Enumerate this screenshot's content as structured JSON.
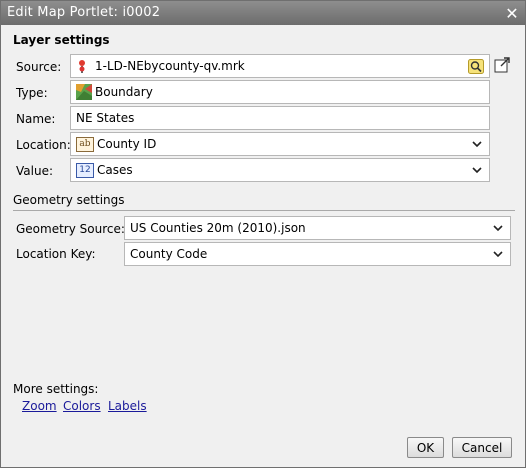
{
  "window": {
    "title": "Edit Map Portlet: i0002"
  },
  "layer": {
    "heading": "Layer settings",
    "source_label": "Source:",
    "source_value": "1-LD-NEbycounty-qv.mrk",
    "type_label": "Type:",
    "type_value": "Boundary",
    "name_label": "Name:",
    "name_value": "NE States",
    "location_label": "Location:",
    "location_value": "County ID",
    "value_label": "Value:",
    "value_value": "Cases",
    "location_type_tag": "ab",
    "value_type_tag": "12"
  },
  "geometry": {
    "heading": "Geometry settings",
    "source_label": "Geometry Source:",
    "source_value": "US Counties 20m (2010).json",
    "key_label": "Location Key:",
    "key_value": "County Code"
  },
  "more": {
    "label": "More settings:",
    "links": [
      "Zoom",
      "Colors",
      "Labels"
    ]
  },
  "buttons": {
    "ok": "OK",
    "cancel": "Cancel"
  },
  "colors": {
    "titlebar": "#7a7a7a",
    "link": "#1a1a9a",
    "dialog_bg": "#f0f0f0"
  }
}
